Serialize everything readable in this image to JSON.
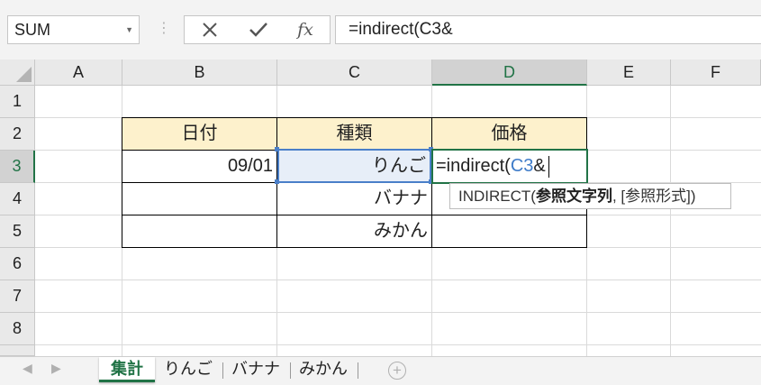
{
  "formula_bar": {
    "name_box": "SUM",
    "cancel_icon": "close-icon",
    "enter_icon": "check-icon",
    "function_label": "fx",
    "formula": "=indirect(C3&"
  },
  "columns": [
    "A",
    "B",
    "C",
    "D",
    "E",
    "F"
  ],
  "rows": [
    "1",
    "2",
    "3",
    "4",
    "5",
    "6",
    "7",
    "8"
  ],
  "selection": {
    "active_column": "D",
    "active_row": "3",
    "reference_cell": "C3"
  },
  "table": {
    "headers": {
      "B2": "日付",
      "C2": "種類",
      "D2": "価格"
    },
    "B3": "09/01",
    "C3": "りんご",
    "C4": "バナナ",
    "C5": "みかん",
    "D3_editing": {
      "prefix": "=indirect(",
      "ref": "C3",
      "suffix": "&"
    }
  },
  "tooltip": {
    "function_name": "INDIRECT(",
    "arg_bold": "参照文字列",
    "rest": ", [参照形式])"
  },
  "colors": {
    "header_fill": "#fdf1cc",
    "excel_green": "#217346",
    "reference_blue": "#4a7fc9"
  },
  "sheet_tabs": [
    {
      "label": "集計",
      "active": true
    },
    {
      "label": "りんご",
      "active": false
    },
    {
      "label": "バナナ",
      "active": false
    },
    {
      "label": "みかん",
      "active": false
    }
  ],
  "add_sheet_icon": "plus-circle-icon"
}
